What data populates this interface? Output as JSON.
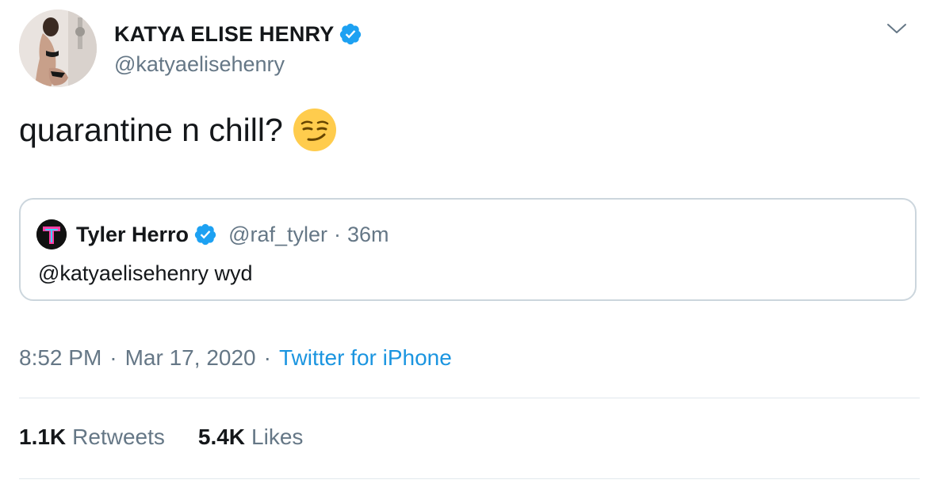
{
  "author": {
    "display_name": "KATYA ELISE HENRY",
    "handle": "@katyaelisehenry",
    "verified": true
  },
  "tweet": {
    "text": "quarantine n chill?",
    "emoji": "smirking-face"
  },
  "quoted_tweet": {
    "display_name": "Tyler Herro",
    "handle": "@raf_tyler",
    "separator": "·",
    "time": "36m",
    "text": "@katyaelisehenry wyd",
    "verified": true
  },
  "meta": {
    "time": "8:52 PM",
    "separator": "·",
    "date": "Mar 17, 2020",
    "source": "Twitter for iPhone"
  },
  "stats": {
    "retweets_count": "1.1K",
    "retweets_label": "Retweets",
    "likes_count": "5.4K",
    "likes_label": "Likes"
  },
  "colors": {
    "verified": "#1da1f2",
    "link": "#1b95e0",
    "secondary_text": "#657786",
    "border": "#ccd6dd"
  },
  "icons": [
    "verified-badge-icon",
    "chevron-down-icon",
    "smirking-face-emoji"
  ]
}
